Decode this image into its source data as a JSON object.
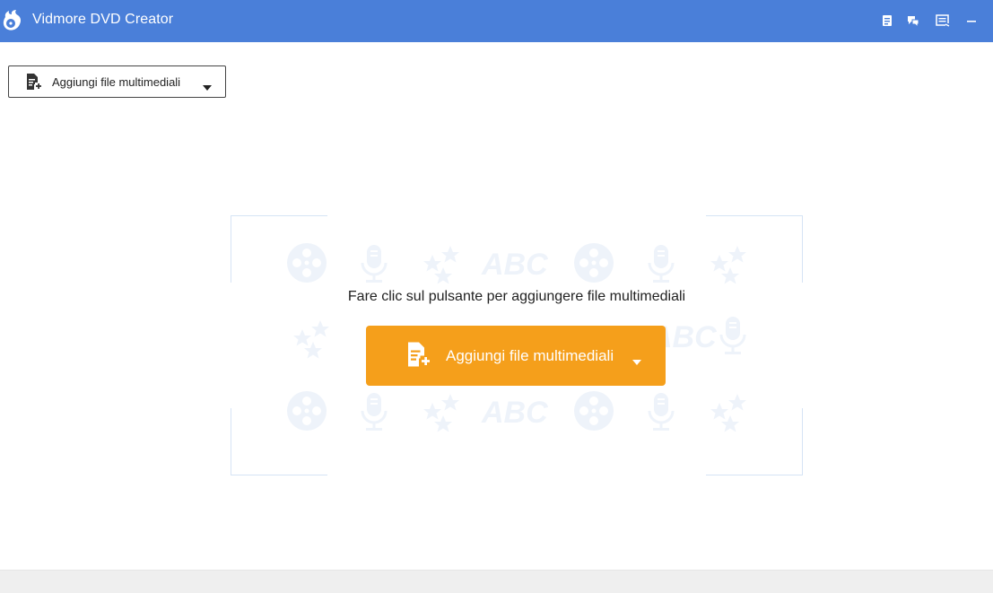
{
  "window": {
    "title": "Vidmore DVD Creator",
    "brand_color": "#4a7fd9",
    "controls": [
      {
        "name": "register-icon"
      },
      {
        "name": "feedback-icon"
      },
      {
        "name": "menu-icon"
      },
      {
        "name": "minimize-icon"
      }
    ]
  },
  "toolbar": {
    "add_media_label": "Aggiungi file multimediali"
  },
  "dropzone": {
    "hint": "Fare clic sul pulsante per aggiungere file multimediali",
    "button_label": "Aggiungi file multimediali",
    "button_color": "#f59f1b",
    "pattern_text": "ABC"
  }
}
